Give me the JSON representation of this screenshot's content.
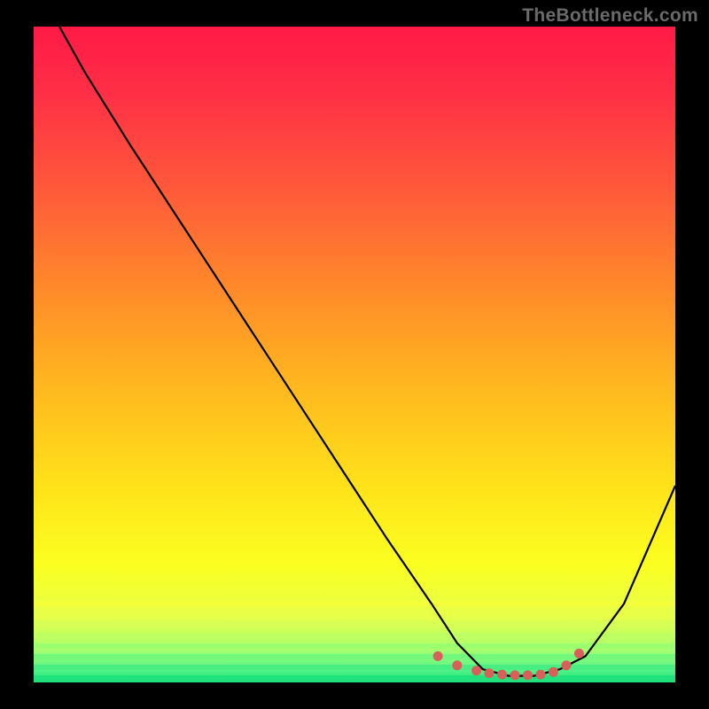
{
  "watermark": "TheBottleneck.com",
  "chart_data": {
    "type": "line",
    "title": "",
    "xlabel": "",
    "ylabel": "",
    "xlim": [
      0,
      100
    ],
    "ylim": [
      0,
      100
    ],
    "grid": false,
    "legend": false,
    "series": [
      {
        "name": "bottleneck-curve",
        "color": "#000000",
        "x": [
          4,
          8,
          15,
          25,
          35,
          45,
          55,
          62,
          66,
          70,
          74,
          78,
          82,
          86,
          92,
          100
        ],
        "values": [
          100,
          93,
          82,
          67,
          52,
          37,
          22,
          12,
          6,
          2,
          1,
          1,
          2,
          4,
          12,
          30
        ]
      }
    ],
    "markers": {
      "name": "highlight-dots",
      "color": "#d9605a",
      "x": [
        63,
        66,
        69,
        71,
        73,
        75,
        77,
        79,
        81,
        83,
        85
      ],
      "values": [
        4.0,
        2.6,
        1.8,
        1.4,
        1.2,
        1.1,
        1.1,
        1.2,
        1.6,
        2.6,
        4.4
      ]
    },
    "gradient_stops": [
      {
        "pos": 0.0,
        "color": "#ff1a46"
      },
      {
        "pos": 0.25,
        "color": "#ff5a3a"
      },
      {
        "pos": 0.55,
        "color": "#ffb81f"
      },
      {
        "pos": 0.82,
        "color": "#fbff20"
      },
      {
        "pos": 0.95,
        "color": "#a8ff6e"
      },
      {
        "pos": 1.0,
        "color": "#18e07a"
      }
    ]
  }
}
